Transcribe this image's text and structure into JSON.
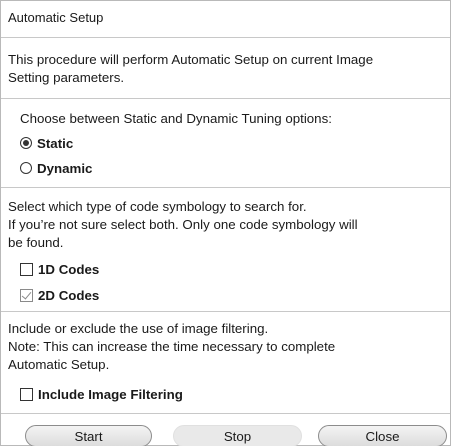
{
  "title": "Automatic Setup",
  "intro": {
    "line1": "This procedure will perform Automatic Setup on current Image",
    "line2": "Setting parameters."
  },
  "tuning": {
    "prompt": "Choose between Static and Dynamic Tuning options:",
    "options": [
      {
        "label": "Static",
        "selected": true
      },
      {
        "label": "Dynamic",
        "selected": false
      }
    ]
  },
  "symbology": {
    "line1": "Select which type of code symbology to search for.",
    "line2": "If you’re not sure select both. Only one code symbology will",
    "line3": "be found.",
    "options": [
      {
        "label": "1D Codes",
        "checked": false
      },
      {
        "label": "2D Codes",
        "checked": true
      }
    ]
  },
  "filtering": {
    "line1": "Include or exclude the use of image filtering.",
    "line2": "Note: This can increase the time necessary to complete",
    "line3": "Automatic Setup.",
    "option": {
      "label": "Include Image Filtering",
      "checked": false
    }
  },
  "buttons": {
    "start": "Start",
    "stop": "Stop",
    "close": "Close"
  }
}
